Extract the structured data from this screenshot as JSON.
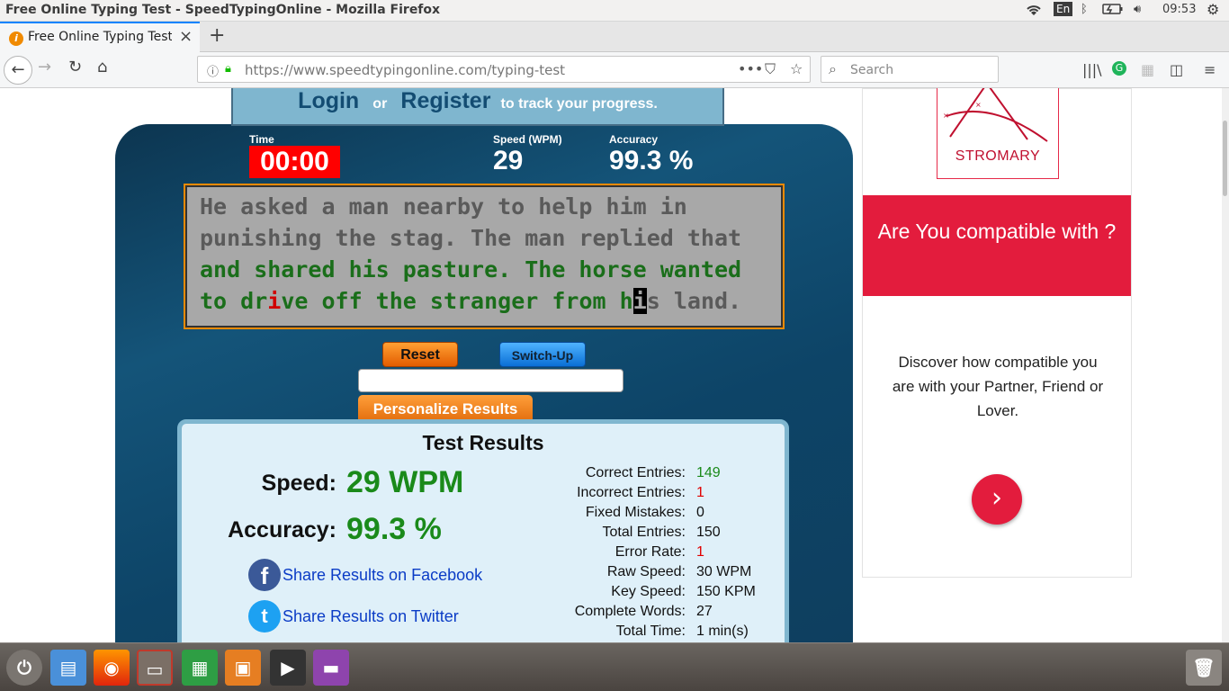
{
  "system": {
    "window_title": "Free Online Typing Test - SpeedTypingOnline - Mozilla Firefox",
    "keyboard_layout": "En",
    "clock": "09:53"
  },
  "browser": {
    "tab_title": "Free Online Typing Test",
    "url_host": "https://www.speedtypingonline.com",
    "url_path": "/typing-test",
    "search_placeholder": "Search"
  },
  "site": {
    "login": "Login",
    "or": "or",
    "register": "Register",
    "track": "to track your progress."
  },
  "test": {
    "time_label": "Time",
    "time_value": "00:00",
    "speed_label": "Speed (WPM)",
    "speed_value": "29",
    "accuracy_label": "Accuracy",
    "accuracy_value": "99.3 %",
    "text_lines": [
      "He asked a man nearby to help him in",
      "punishing the stag. The man replied that",
      "and shared his pasture. The horse wanted",
      "to drive off the stranger from his land."
    ],
    "reset_label": "Reset",
    "switch_label": "Switch-Up",
    "personalize_label": "Personalize Results"
  },
  "results": {
    "title": "Test Results",
    "speed_label": "Speed:",
    "speed_value": "29 WPM",
    "accuracy_label": "Accuracy:",
    "accuracy_value": "99.3 %",
    "share_facebook": "Share Results on Facebook",
    "share_twitter": "Share Results on Twitter",
    "stats": [
      {
        "key": "Correct Entries:",
        "value": "149"
      },
      {
        "key": "Incorrect Entries:",
        "value": "1"
      },
      {
        "key": "Fixed Mistakes:",
        "value": "0"
      },
      {
        "key": "Total Entries:",
        "value": "150"
      },
      {
        "key": "Error Rate:",
        "value": "1"
      },
      {
        "key": "Raw Speed:",
        "value": "30 WPM"
      },
      {
        "key": "Key Speed:",
        "value": "150 KPM"
      },
      {
        "key": "Complete Words:",
        "value": "27"
      },
      {
        "key": "Total Time:",
        "value": "1 min(s)"
      }
    ]
  },
  "ad": {
    "brand": "STROMARY",
    "headline": "Are You compatible with ?",
    "body": "Discover how compatible you are with your Partner, Friend or Lover.",
    "accent_color": "#e31c3d"
  }
}
